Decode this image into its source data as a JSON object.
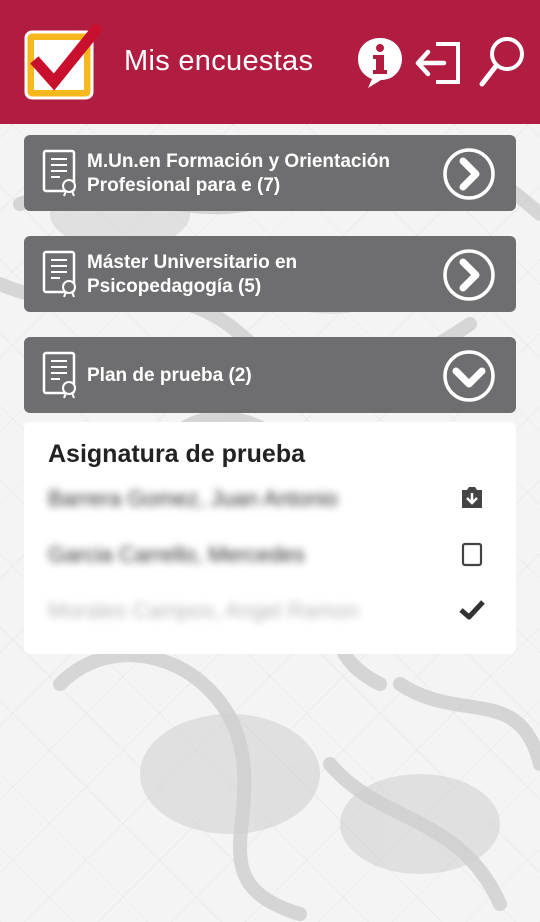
{
  "header": {
    "title": "Mis encuestas",
    "bg_color": "#b01d40",
    "logo_icon": "checkbox-logo-icon",
    "actions": [
      {
        "name": "info-icon"
      },
      {
        "name": "logout-icon"
      },
      {
        "name": "search-icon"
      }
    ]
  },
  "programs": [
    {
      "label": "M.Un.en Formación y Orientación Profesional para e (7)",
      "state": "collapsed",
      "icon": "chevron-right-circle-icon"
    },
    {
      "label": "Máster Universitario en Psicopedagogía (5)",
      "state": "collapsed",
      "icon": "chevron-right-circle-icon"
    },
    {
      "label": "Plan de prueba (2)",
      "state": "expanded",
      "icon": "chevron-down-circle-icon"
    }
  ],
  "subject_panel": {
    "title": "Asignatura de prueba",
    "rows": [
      {
        "name": "Barrera Gomez, Juan Antonio",
        "status_icon": "download-icon"
      },
      {
        "name": "Garcia Carrello, Mercedes",
        "status_icon": "empty-checkbox-icon"
      },
      {
        "name": "Morales Campos, Angel Ramon",
        "status_icon": "checkmark-icon"
      }
    ]
  },
  "colors": {
    "card": "#6e6e70",
    "accent": "#b01d40"
  }
}
